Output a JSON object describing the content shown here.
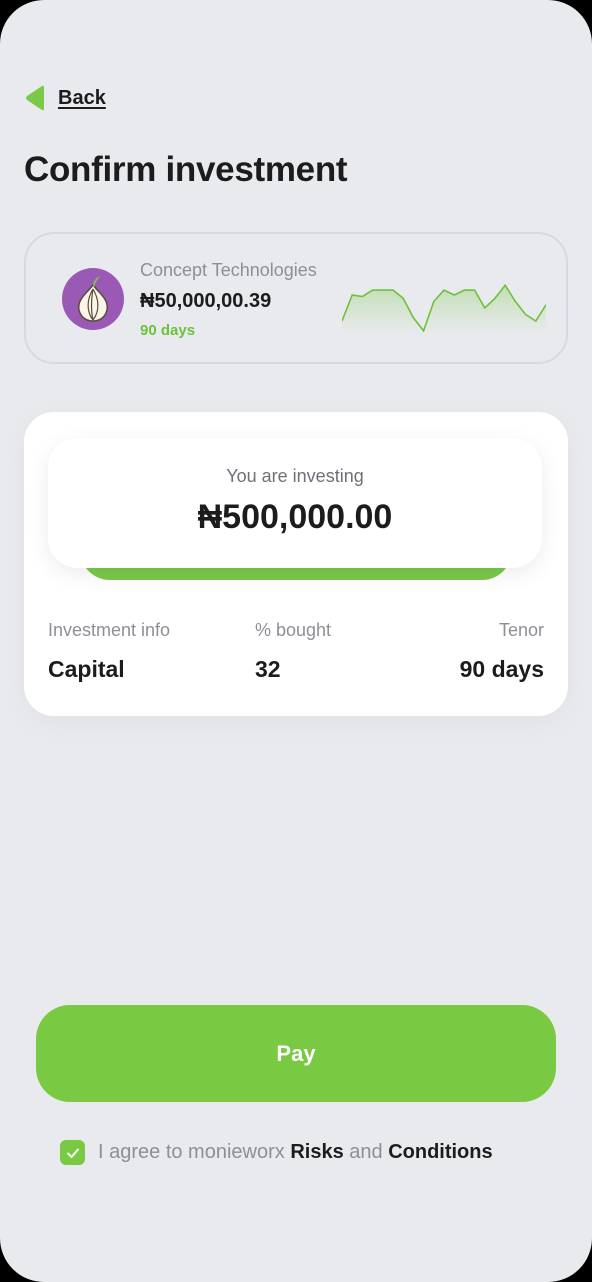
{
  "nav": {
    "back_label": "Back"
  },
  "page": {
    "title": "Confirm investment"
  },
  "asset": {
    "name": "Concept Technologies",
    "price": "₦50,000,00.39",
    "tenor": "90 days",
    "logo_icon": "onion-icon",
    "logo_bg": "#9b59b6",
    "sparkline_color": "#6cc23a",
    "sparkline": [
      24,
      8,
      9,
      5,
      5,
      5,
      10,
      22,
      30,
      12,
      5,
      8,
      5,
      5,
      16,
      10,
      2,
      12,
      20,
      24,
      14
    ]
  },
  "investment": {
    "caption": "You are investing",
    "amount": "₦500,000.00",
    "info": [
      {
        "label": "Investment info",
        "value": "Capital"
      },
      {
        "label": "% bought",
        "value": "32"
      },
      {
        "label": "Tenor",
        "value": "90 days"
      }
    ]
  },
  "actions": {
    "pay_label": "Pay"
  },
  "agreement": {
    "checked": true,
    "prefix": "I agree to monieworx ",
    "risks": "Risks",
    "middle": " and ",
    "conditions": "Conditions"
  },
  "colors": {
    "accent": "#79c943",
    "background": "#e9eaee",
    "text": "#1c1c1e",
    "muted": "#8e8f96"
  }
}
